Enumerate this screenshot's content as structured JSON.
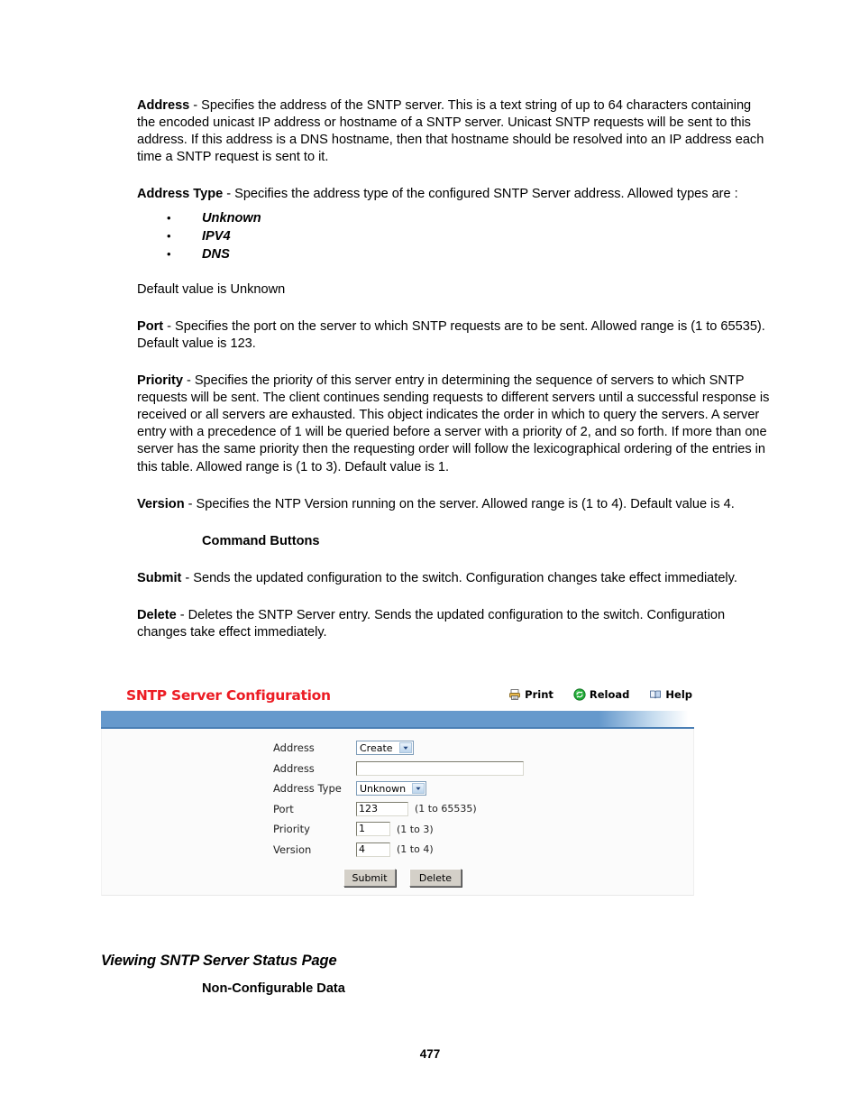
{
  "document": {
    "page_number": "477",
    "paragraphs": [
      {
        "term": "Address",
        "text": " - Specifies the address of the SNTP server. This is a text string of up to 64 characters containing the encoded unicast IP address or hostname of a SNTP server. Unicast SNTP requests will be sent to this address. If this address is a DNS hostname, then that hostname should be resolved into an IP address each time a SNTP request is sent to it."
      },
      {
        "term": "Address Type",
        "text": " - Specifies the address type of the configured SNTP Server address. Allowed types are :"
      }
    ],
    "address_type_options": [
      "Unknown",
      "IPV4",
      "DNS"
    ],
    "default_note": "Default value is Unknown",
    "port_paragraph": {
      "term": "Port",
      "text": " - Specifies the port on the server to which SNTP requests are to be sent. Allowed range is (1 to 65535). Default value is 123."
    },
    "priority_paragraph": {
      "term": "Priority",
      "text": " - Specifies the priority of this server entry in determining the sequence of servers to which SNTP requests will be sent. The client continues sending requests to different servers until a successful response is received or all servers are exhausted. This object indicates the order in which to query the servers. A server entry with a precedence of 1 will be queried before a server with a priority of 2, and so forth. If more than one server has the same priority then the requesting order will follow the lexicographical ordering of the entries in this table. Allowed range is (1 to 3). Default value is 1."
    },
    "version_paragraph": {
      "term": "Version",
      "text": " - Specifies the NTP Version running on the server. Allowed range is (1 to 4). Default value is 4."
    },
    "command_buttons_heading": "Command Buttons",
    "submit_paragraph": {
      "term": "Submit",
      "text": " - Sends the updated configuration to the switch. Configuration changes take effect immediately."
    },
    "delete_paragraph": {
      "term": "Delete",
      "text": " - Deletes the SNTP Server entry. Sends the updated configuration to the switch. Configuration changes take effect immediately."
    },
    "section_heading": "Viewing SNTP Server Status Page",
    "section_subheading": "Non-Configurable Data"
  },
  "screenshot": {
    "title": "SNTP Server Configuration",
    "title_color": "#ec1c24",
    "accent_bar_color": "#6699cc",
    "toolbar": [
      {
        "label": "Print",
        "icon": "printer-icon"
      },
      {
        "label": "Reload",
        "icon": "reload-icon"
      },
      {
        "label": "Help",
        "icon": "book-icon"
      }
    ],
    "fields": [
      {
        "label": "Address",
        "type": "select",
        "value": "Create",
        "hint": ""
      },
      {
        "label": "Address",
        "type": "text",
        "value": "",
        "hint": ""
      },
      {
        "label": "Address Type",
        "type": "select",
        "value": "Unknown",
        "hint": ""
      },
      {
        "label": "Port",
        "type": "text",
        "value": "123",
        "hint": "(1 to 65535)"
      },
      {
        "label": "Priority",
        "type": "text",
        "value": "1",
        "hint": "(1 to 3)"
      },
      {
        "label": "Version",
        "type": "text",
        "value": "4",
        "hint": "(1 to 4)"
      }
    ],
    "buttons": [
      {
        "label": "Submit"
      },
      {
        "label": "Delete"
      }
    ]
  }
}
